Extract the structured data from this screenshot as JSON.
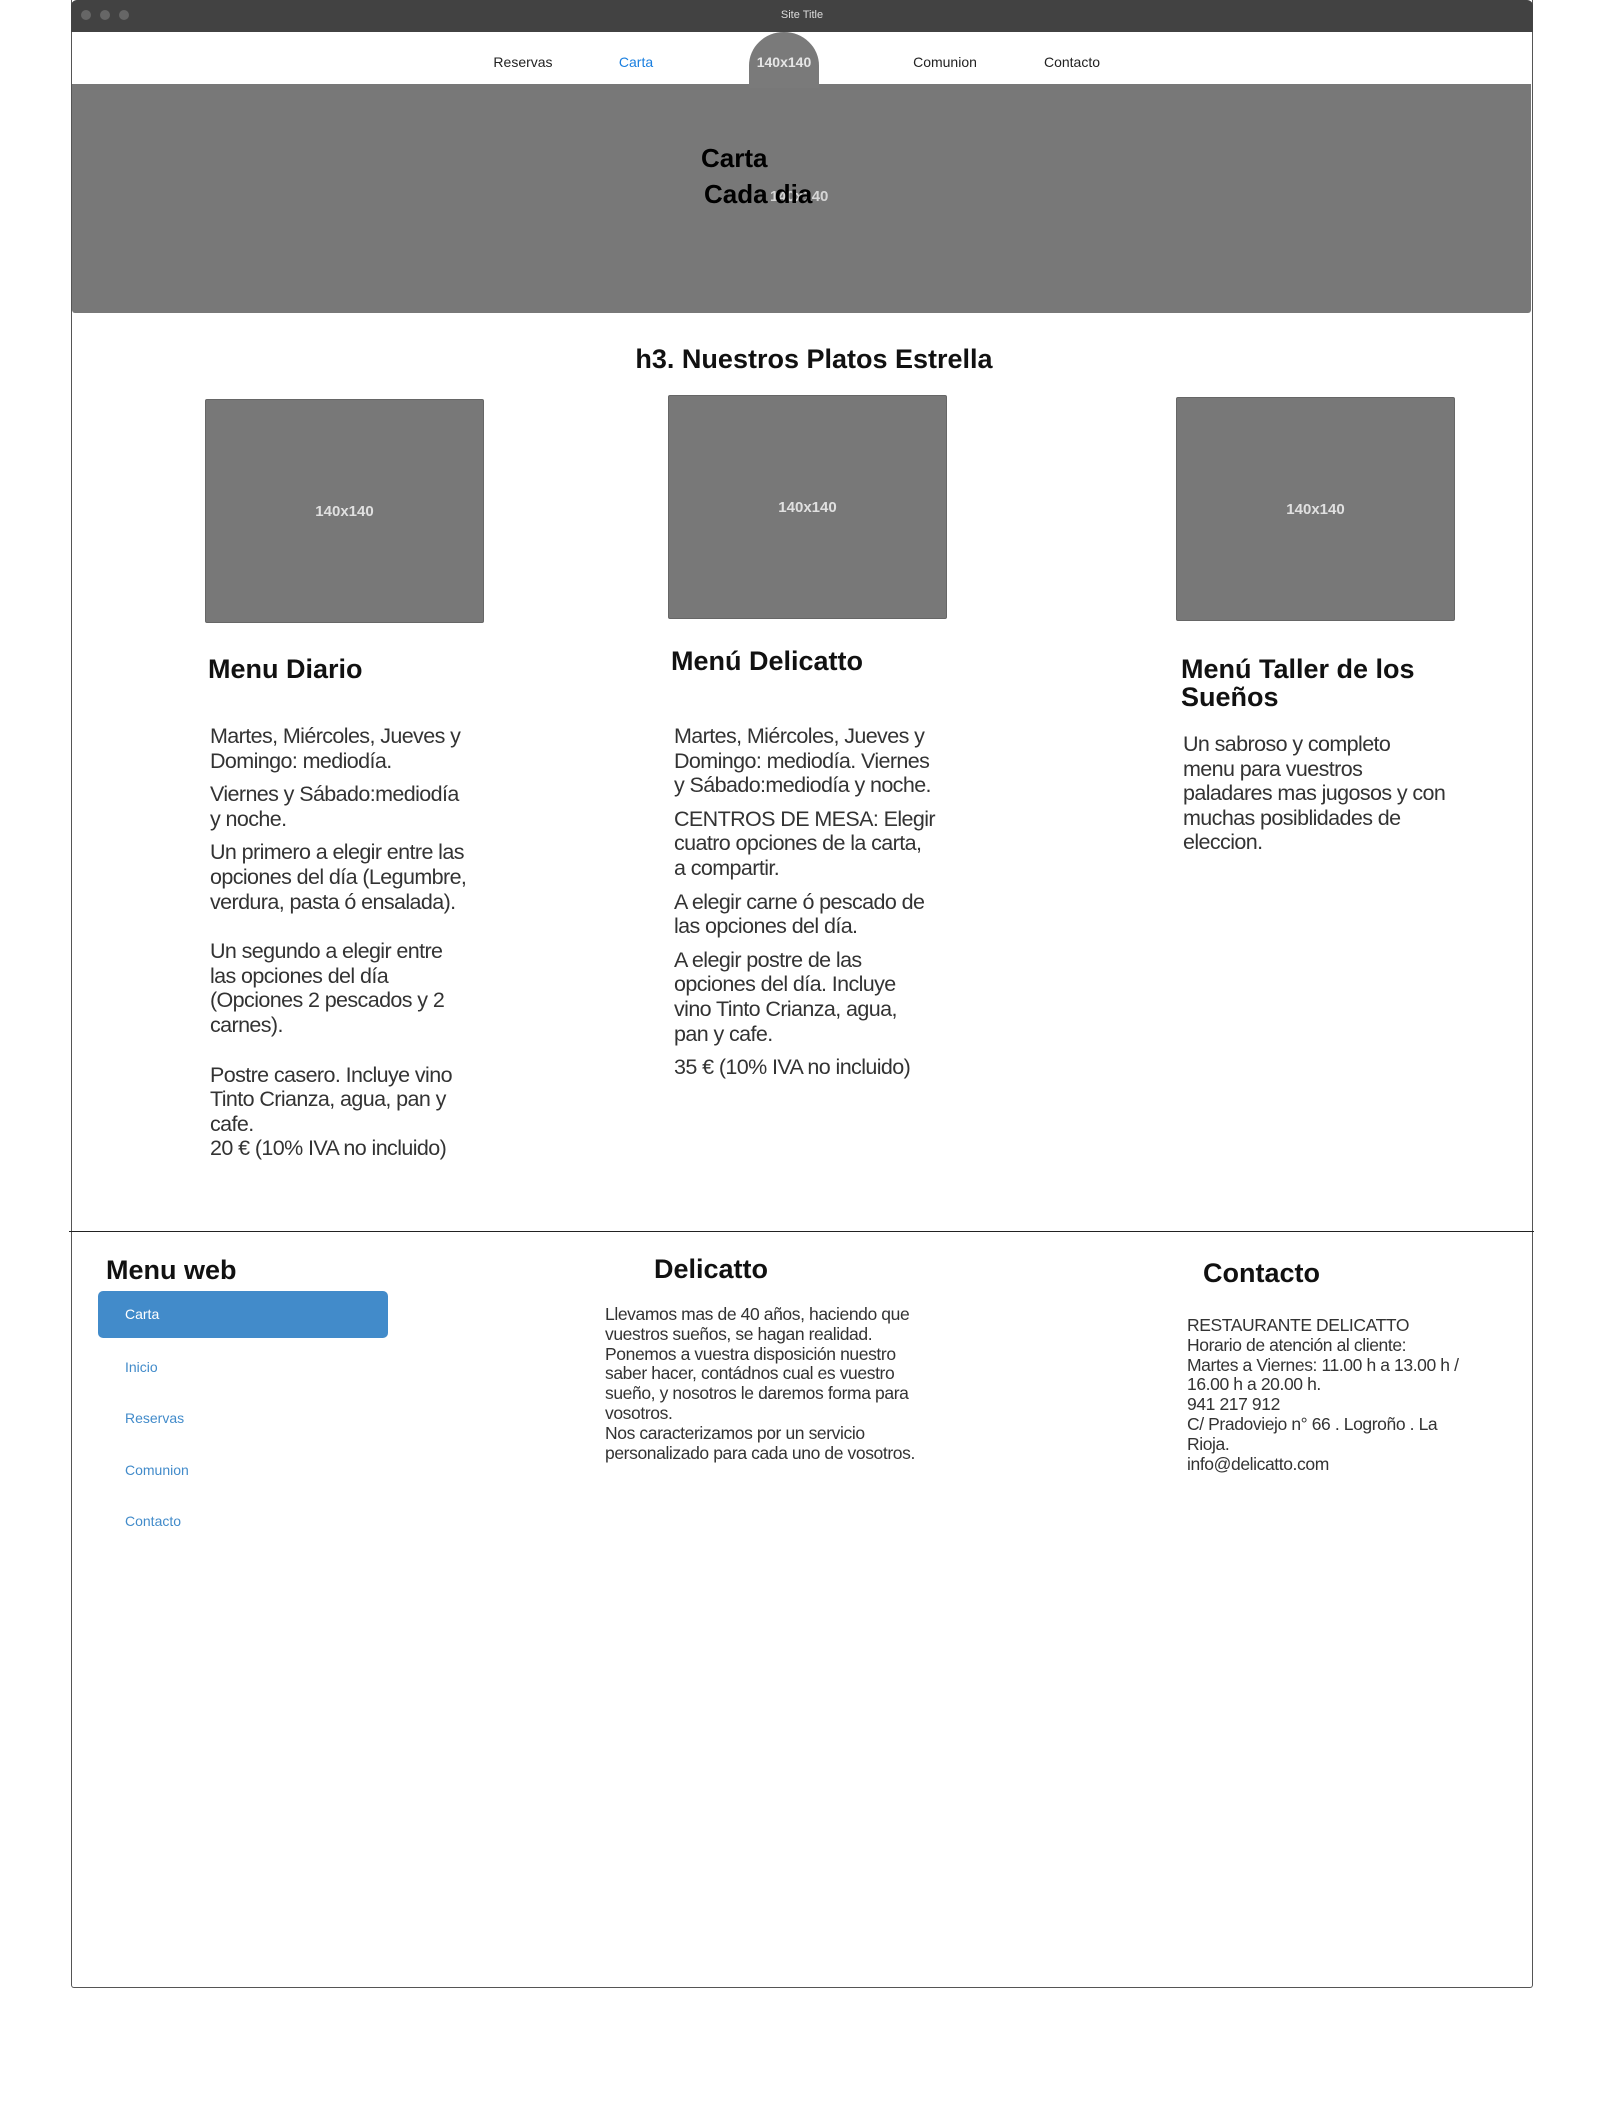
{
  "window": {
    "title": "Site Title"
  },
  "nav": {
    "items": [
      {
        "label": "Reservas",
        "active": false
      },
      {
        "label": "Carta",
        "active": true
      },
      {
        "label": "Comunion",
        "active": false
      },
      {
        "label": "Contacto",
        "active": false
      }
    ],
    "logo_placeholder": "140x140"
  },
  "hero": {
    "title": "Carta",
    "subtitle": "Cada dia",
    "placeholder": "140x140"
  },
  "section": {
    "heading": "h3. Nuestros Platos Estrella"
  },
  "cards": [
    {
      "image": "140x140",
      "title": "Menu Diario",
      "paragraphs": [
        "Martes, Miércoles, Jueves y\nDomingo: mediodía.",
        "Viernes y Sábado:mediodía\ny noche.",
        "Un primero a elegir entre las\nopciones del día (Legumbre,\nverdura, pasta ó ensalada).",
        "Un segundo a elegir entre\nlas opciones del día\n(Opciones 2 pescados y 2\ncarnes).",
        "Postre casero. Incluye vino\nTinto Crianza, agua, pan y\ncafe.\n20 € (10% IVA no incluido)"
      ]
    },
    {
      "image": "140x140",
      "title": "Menú Delicatto",
      "paragraphs": [
        "Martes, Miércoles, Jueves y\nDomingo: mediodía. Viernes\ny Sábado:mediodía y noche.",
        "CENTROS DE MESA: Elegir\ncuatro opciones de la carta,\na compartir.",
        "A elegir carne ó pescado de\nlas opciones del día.",
        "A elegir postre de las\nopciones del día. Incluye\nvino Tinto Crianza, agua,\npan y cafe.",
        "35 € (10% IVA no incluido)"
      ]
    },
    {
      "image": "140x140",
      "title": "Menú Taller de los\nSueños",
      "paragraphs": [
        "Un sabroso y completo\nmenu para vuestros\npaladares mas jugosos y con\nmuchas posiblidades de\neleccion."
      ]
    }
  ],
  "footer": {
    "menu": {
      "heading": "Menu web",
      "items": [
        {
          "label": "Carta",
          "active": true
        },
        {
          "label": "Inicio"
        },
        {
          "label": "Reservas"
        },
        {
          "label": "Comunion"
        },
        {
          "label": "Contacto"
        }
      ]
    },
    "about": {
      "heading": "Delicatto",
      "text": "Llevamos mas de 40 años, haciendo que\nvuestros sueños, se hagan realidad.\nPonemos a vuestra disposición nuestro\nsaber hacer, contádnos cual es vuestro\nsueño, y nosotros le daremos forma para\nvosotros.\nNos caracterizamos por un servicio\npersonalizado para cada uno de vosotros."
    },
    "contact": {
      "heading": "Contacto",
      "text": "RESTAURANTE DELICATTO\nHorario de atención al cliente:\nMartes a Viernes: 11.00 h a 13.00 h /\n16.00 h a 20.00 h.\n941 217 912\nC/ Pradoviejo n° 66 . Logroño . La\nRioja.\ninfo@delicatto.com"
    }
  },
  "colors": {
    "accent": "#428bca",
    "nav_active": "#1a7fe0",
    "placeholder": "#787878",
    "titlebar": "#424242"
  }
}
